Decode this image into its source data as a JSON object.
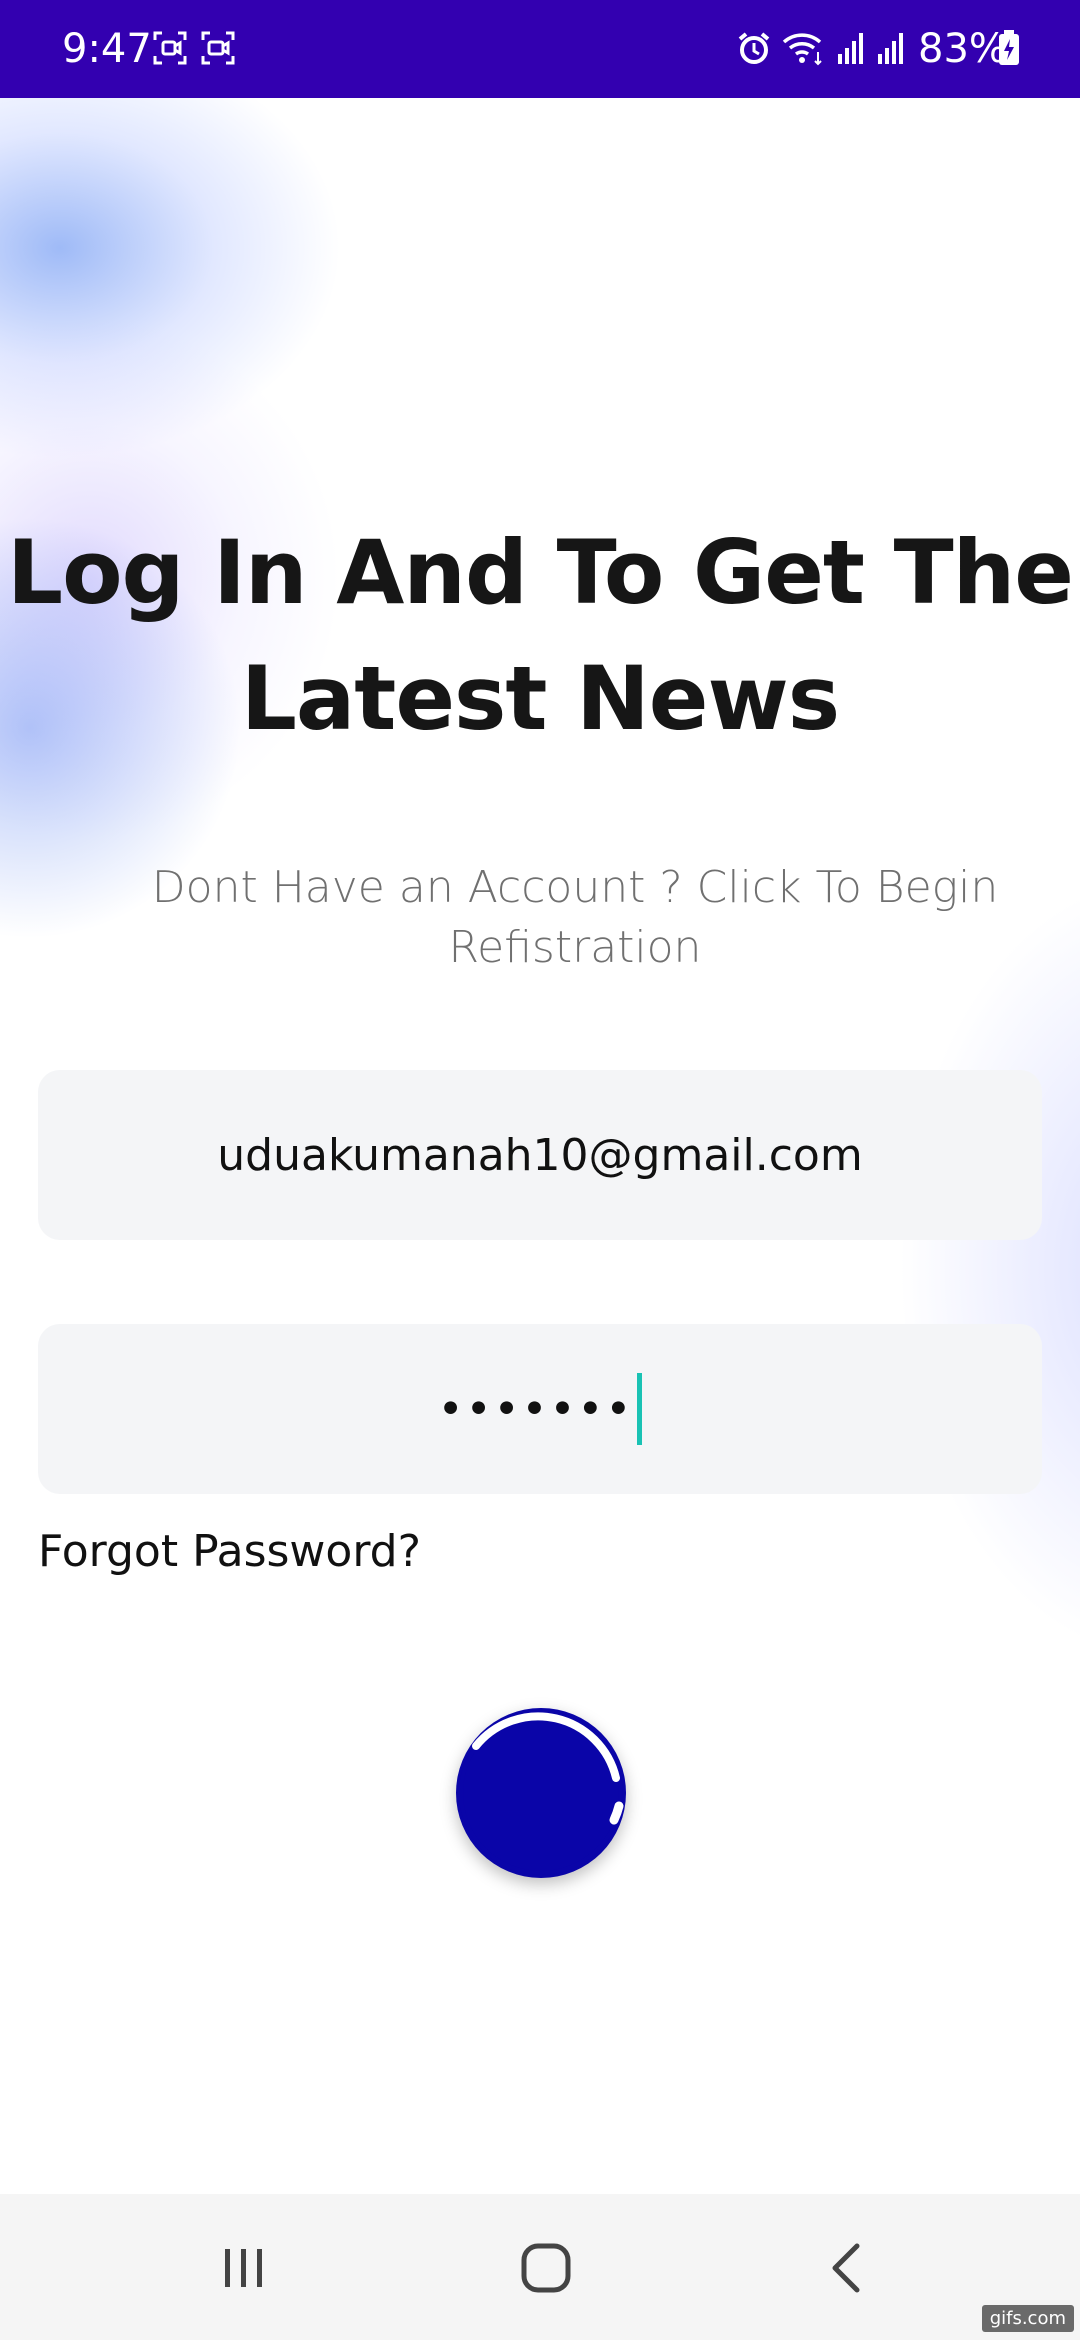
{
  "status_bar": {
    "time": "9:47",
    "battery_percent": "83%",
    "background_color": "#3300b0",
    "icons": [
      "screenshot-icon",
      "screen-record-icon",
      "alarm-icon",
      "wifi-icon",
      "signal-icon",
      "signal-icon",
      "battery-charging-icon"
    ]
  },
  "login": {
    "headline_line1": "Log In And To Get The",
    "headline_line2": "Latest News",
    "subtitle_line1": "Dont Have an Account ? Click To Begin",
    "subtitle_line2": "Refistration",
    "email_value": "uduakumanah10@gmail.com",
    "password_value": "•••••••",
    "forgot_password_label": "Forgot Password?",
    "submit_state": "loading",
    "accent_color": "#0a05a8",
    "caret_color": "#19c2b4"
  },
  "nav_bar": {
    "buttons": [
      "recents-icon",
      "home-icon",
      "back-icon"
    ]
  },
  "watermark": "gifs.com"
}
